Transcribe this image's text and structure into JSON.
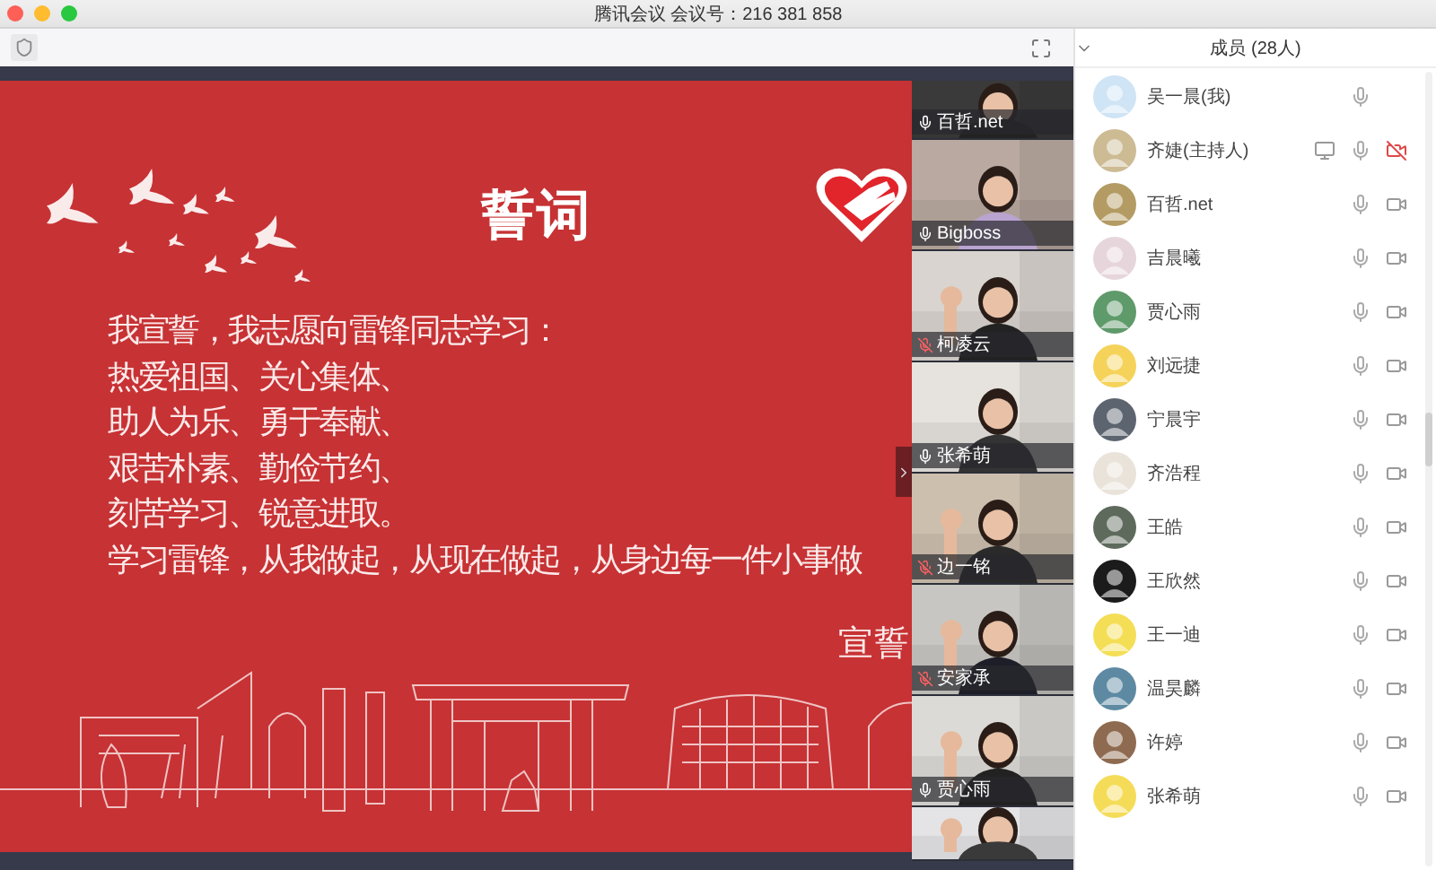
{
  "window": {
    "title": "腾讯会议 会议号：216 381 858"
  },
  "slide": {
    "title": "誓词",
    "lines": [
      "我宣誓，我志愿向雷锋同志学习：",
      "热爱祖国、关心集体、",
      "助人为乐、勇于奉献、",
      "艰苦朴素、勤俭节约、",
      "刻苦学习、锐意进取。",
      "学习雷锋，从我做起，从现在做起，从身边每一件小事做"
    ],
    "signature": "宣誓"
  },
  "tiles": [
    {
      "kind": "labeled",
      "name": "百哲.net",
      "muted": false
    },
    {
      "kind": "labeled",
      "name": "Bigboss",
      "muted": false
    },
    {
      "kind": "labeled",
      "name": "柯凌云",
      "muted": true
    },
    {
      "kind": "labeled",
      "name": "张希萌",
      "muted": false
    },
    {
      "kind": "labeled",
      "name": "边一铭",
      "muted": true
    },
    {
      "kind": "labeled",
      "name": "安家承",
      "muted": true
    },
    {
      "kind": "labeled",
      "name": "贾心雨",
      "muted": false
    },
    {
      "kind": "picture"
    }
  ],
  "members_panel": {
    "title": "成员 (28人)"
  },
  "members": [
    {
      "name": "吴一晨(我)",
      "sharing": false
    },
    {
      "name": "齐婕(主持人)",
      "video_off": true,
      "sharing": true
    },
    {
      "name": "百哲.net",
      "video_off": false,
      "sharing": false
    },
    {
      "name": "吉晨曦",
      "video_off": false,
      "sharing": false
    },
    {
      "name": "贾心雨",
      "video_off": false,
      "sharing": false
    },
    {
      "name": "刘远捷",
      "video_off": false,
      "sharing": false
    },
    {
      "name": "宁晨宇",
      "video_off": false,
      "sharing": false
    },
    {
      "name": "齐浩程",
      "video_off": false,
      "sharing": false
    },
    {
      "name": "王皓",
      "video_off": false,
      "sharing": false
    },
    {
      "name": "王欣然",
      "video_off": false,
      "sharing": false
    },
    {
      "name": "王一迪",
      "video_off": false,
      "sharing": false
    },
    {
      "name": "温昊麟",
      "video_off": false,
      "sharing": false
    },
    {
      "name": "许婷",
      "video_off": false,
      "sharing": false
    },
    {
      "name": "张希萌",
      "video_off": false,
      "sharing": false
    }
  ]
}
